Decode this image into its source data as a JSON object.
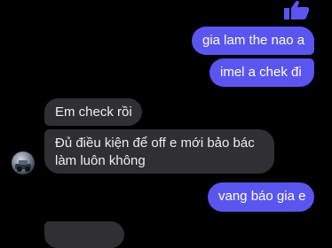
{
  "icons": {
    "like": "thumbs-up-icon",
    "avatar": "contact-avatar"
  },
  "colors": {
    "background": "#000000",
    "sent_bubble": "#5b55f0",
    "received_bubble": "#303033"
  },
  "messages": [
    {
      "direction": "sent",
      "text": "gia lam the nao a"
    },
    {
      "direction": "sent",
      "text": "imel a chek đi"
    },
    {
      "direction": "received",
      "text": "Em check rồi"
    },
    {
      "direction": "received",
      "text": "Đủ điều kiện để off e mới bảo bác làm luôn không"
    },
    {
      "direction": "sent",
      "text": "vang báo gia e"
    },
    {
      "direction": "received",
      "text": ""
    }
  ]
}
